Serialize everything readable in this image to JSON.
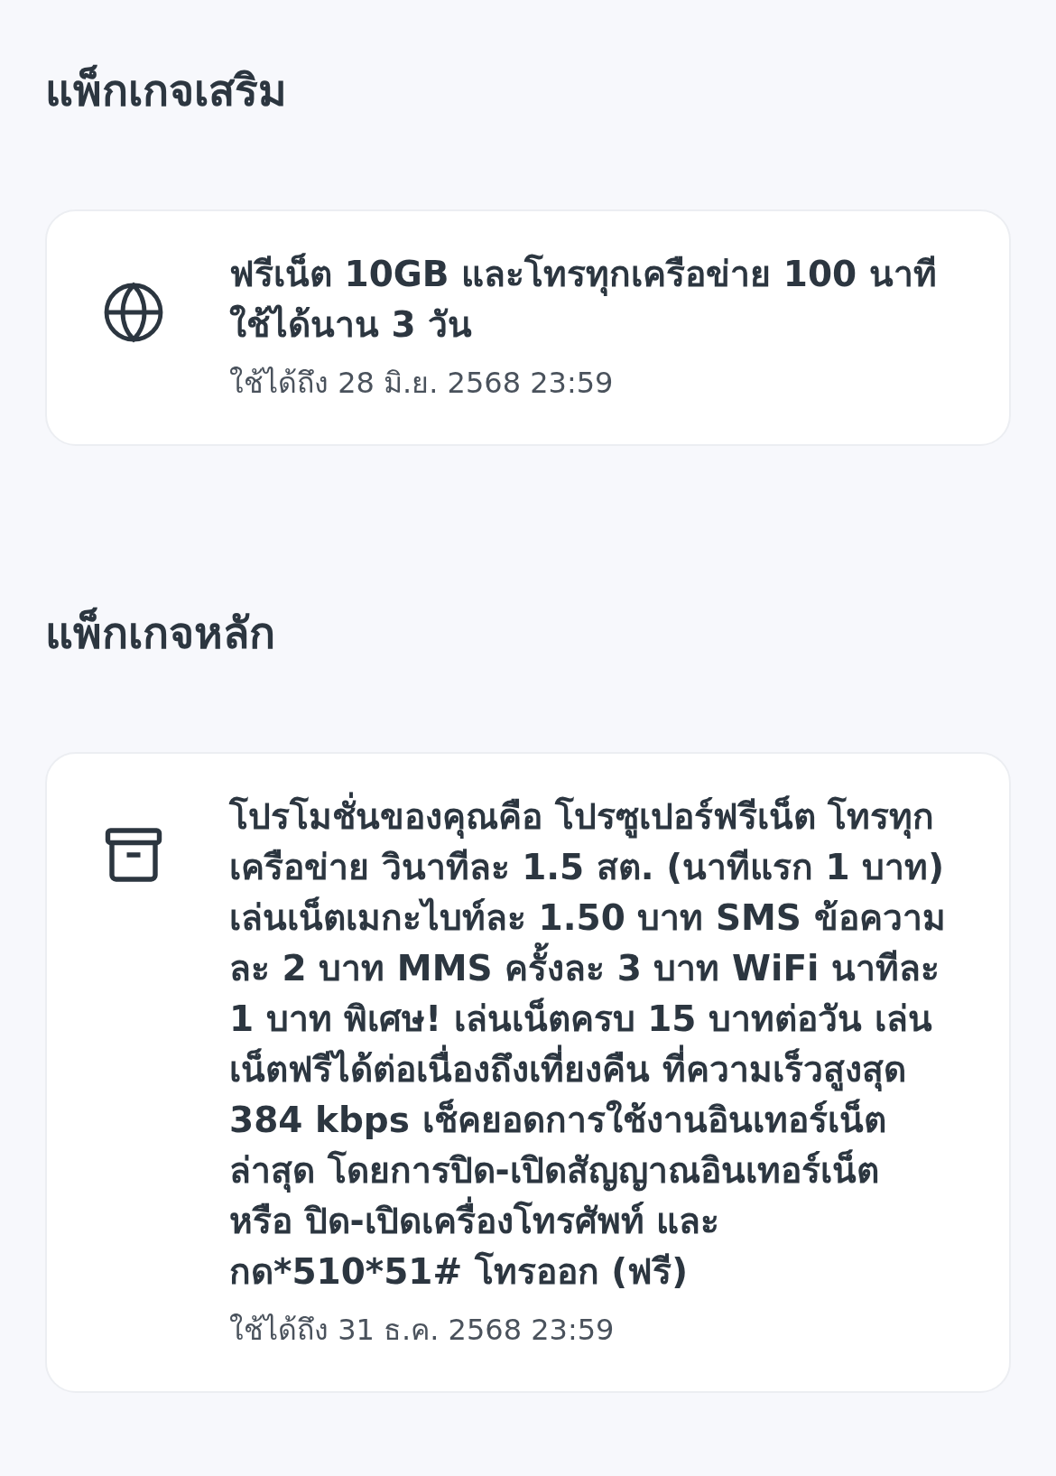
{
  "sections": [
    {
      "title": "แพ็กเกจเสริม",
      "packages": [
        {
          "kind": "globe",
          "name": "ฟรีเน็ต 10GB และโทรทุกเครือข่าย 100 นาที ใช้ได้นาน 3 วัน",
          "validity": "ใช้ได้ถึง 28 มิ.ย. 2568 23:59"
        }
      ]
    },
    {
      "title": "แพ็กเกจหลัก",
      "packages": [
        {
          "kind": "archive",
          "name": "โปรโมชั่นของคุณคือ โปรซูเปอร์ฟรีเน็ต โทรทุกเครือข่าย วินาทีละ 1.5 สต. (นาทีแรก 1 บาท) เล่นเน็ตเมกะไบท์ละ 1.50 บาท SMS ข้อความละ 2 บาท MMS ครั้งละ 3 บาท WiFi นาทีละ 1 บาท พิเศษ! เล่นเน็ตครบ 15 บาทต่อวัน เล่นเน็ตฟรีได้ต่อเนื่องถึงเที่ยงคืน ที่ความเร็วสูงสุด 384 kbps เช็คยอดการใช้งานอินเทอร์เน็ตล่าสุด โดยการปิด-เปิดสัญญาณอินเทอร์เน็ต หรือ ปิด-เปิดเครื่องโทรศัพท์ และกด*510*51# โทรออก (ฟรี)",
          "validity": "ใช้ได้ถึง 31 ธ.ค. 2568 23:59"
        }
      ]
    }
  ]
}
